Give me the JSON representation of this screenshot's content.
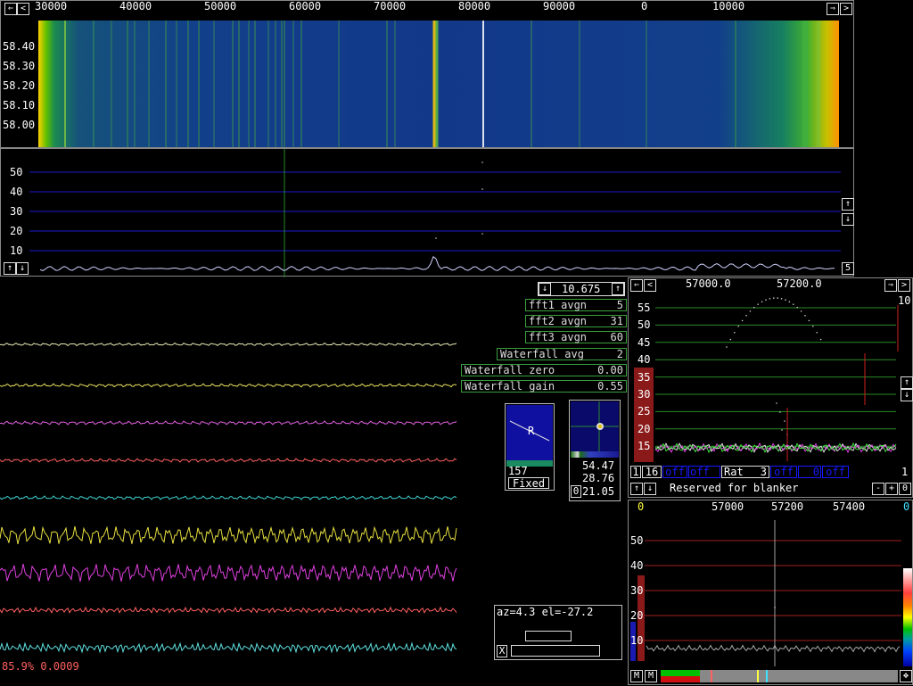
{
  "waterfall": {
    "freq_ticks": [
      "30000",
      "40000",
      "50000",
      "60000",
      "70000",
      "80000",
      "90000",
      "0",
      "10000"
    ],
    "time_ticks": [
      "58.40",
      "58.30",
      "58.20",
      "58.10",
      "58.00"
    ]
  },
  "spectrum": {
    "y_ticks": [
      "50",
      "40",
      "30",
      "20",
      "10"
    ],
    "right_button": "5"
  },
  "params": {
    "bandwidth": "10.675",
    "rows": [
      {
        "label": "fft1 avgn",
        "value": "5"
      },
      {
        "label": "fft2 avgn",
        "value": "31"
      },
      {
        "label": "fft3 avgn",
        "value": "60"
      },
      {
        "label": "Waterfall avg",
        "value": "2"
      },
      {
        "label": "Waterfall zero",
        "value": "0.00"
      },
      {
        "label": "Waterfall gain",
        "value": "0.55"
      }
    ]
  },
  "status": {
    "text": "85.9% 0.0009"
  },
  "meter1": {
    "value": "157",
    "mode": "Fixed",
    "marker": "R"
  },
  "meter2": {
    "v1": "54.47",
    "v2": "28.76",
    "v3": "21.05",
    "btn": "0"
  },
  "azel": {
    "text": "az=4.3 el=-27.2",
    "btn": "X"
  },
  "hires": {
    "freq_ticks": [
      "57000.0",
      "57200.0"
    ],
    "y_ticks": [
      "55",
      "50",
      "45",
      "40",
      "35",
      "30",
      "25",
      "20",
      "15"
    ],
    "right_label": "10",
    "bottom_right": "1",
    "btn_1": "1",
    "btn_16": "16",
    "off1": "off",
    "off2": "off",
    "rat_label": "Rat",
    "rat_value": "3",
    "off3": "off",
    "off4": "0",
    "off5": "off",
    "reserved": "Reserved for blanker",
    "minus": "-",
    "plus": "+",
    "zero": "0"
  },
  "baseband": {
    "freq_ticks": [
      "57000",
      "57200",
      "57400"
    ],
    "left_label": "0",
    "right_label": "0",
    "y_ticks": [
      "50",
      "40",
      "30",
      "20",
      "10"
    ],
    "m1": "M",
    "m2": "M"
  },
  "colors": {
    "grid_blue": "#1a1acc",
    "grid_green": "#2a8a2a",
    "grid_red": "#a02020",
    "box_green": "#3aa03a"
  }
}
